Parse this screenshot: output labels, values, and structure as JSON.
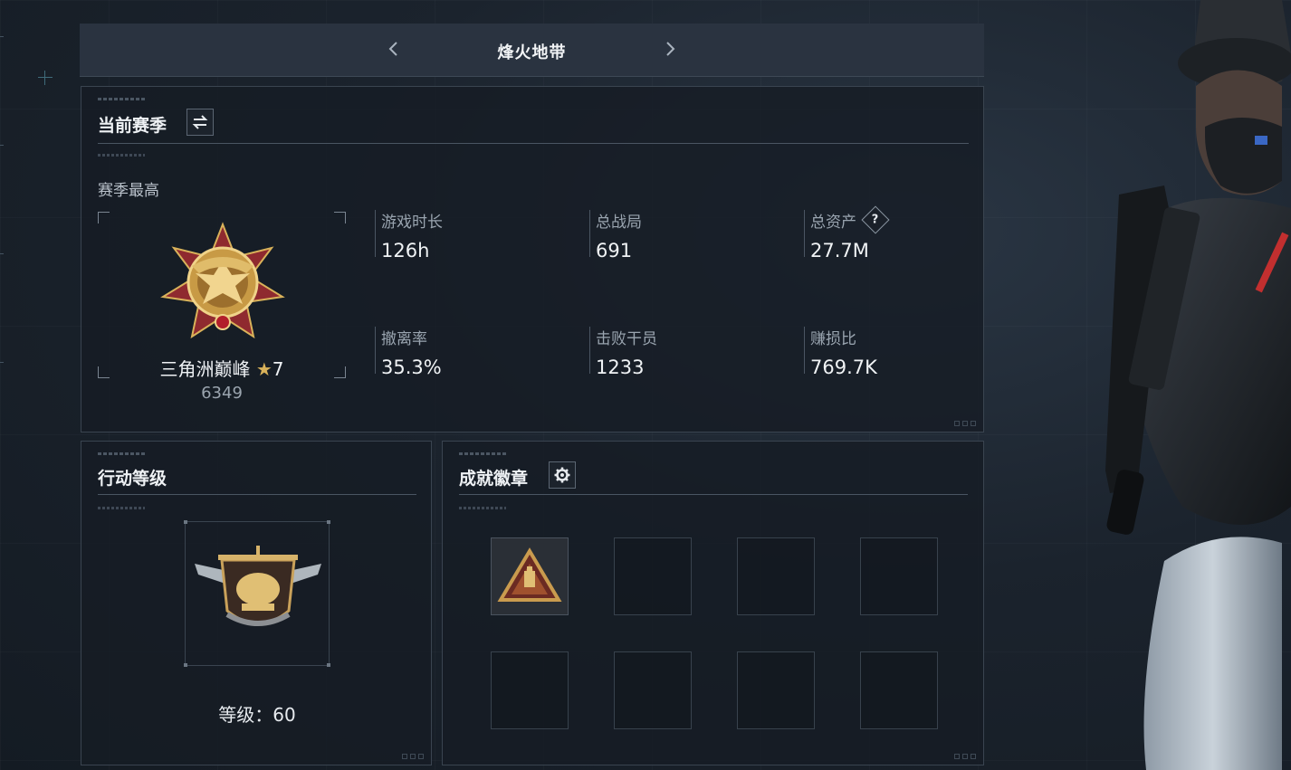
{
  "header": {
    "title": "烽火地带",
    "prev_label": "‹",
    "next_label": "›"
  },
  "season": {
    "title": "当前赛季",
    "subtitle": "赛季最高",
    "rank_name": "三角洲巅峰",
    "rank_stars": "7",
    "rank_score": "6349",
    "stats": [
      {
        "label": "游戏时长",
        "value": "126h"
      },
      {
        "label": "总战局",
        "value": "691"
      },
      {
        "label": "总资产",
        "value": "27.7M",
        "help": "?"
      },
      {
        "label": "撤离率",
        "value": "35.3%"
      },
      {
        "label": "击败干员",
        "value": "1233"
      },
      {
        "label": "赚损比",
        "value": "769.7K"
      }
    ]
  },
  "action_level": {
    "title": "行动等级",
    "level_text": "等级：60"
  },
  "achievements": {
    "title": "成就徽章",
    "slots": [
      "filled",
      "empty",
      "empty",
      "empty",
      "empty",
      "empty",
      "empty",
      "empty"
    ]
  },
  "colors": {
    "background": "#1b232d",
    "panel": "#161c24",
    "gold": "#d9b25a",
    "text": "#e6eaee"
  }
}
